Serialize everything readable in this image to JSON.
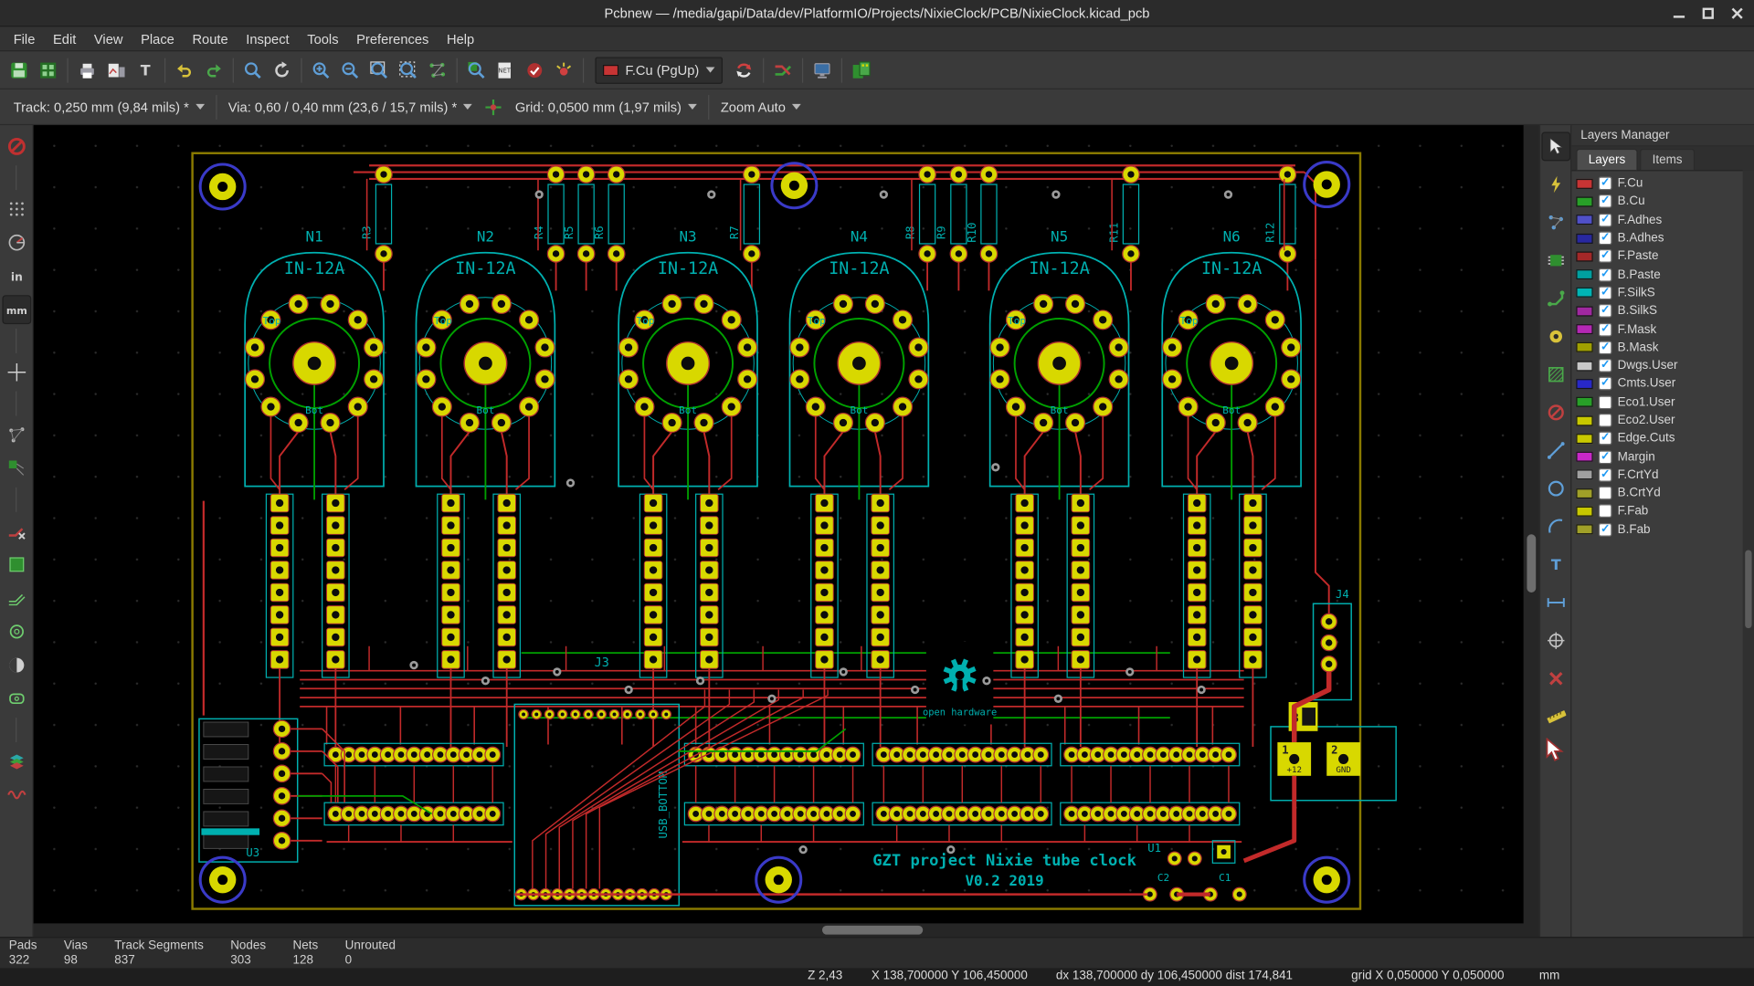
{
  "window": {
    "title": "Pcbnew — /media/gapi/Data/dev/PlatformIO/Projects/NixieClock/PCB/NixieClock.kicad_pcb"
  },
  "menu": {
    "items": [
      "File",
      "Edit",
      "View",
      "Place",
      "Route",
      "Inspect",
      "Tools",
      "Preferences",
      "Help"
    ]
  },
  "toolbar_main": {
    "icons_left": [
      "save-board-icon",
      "footprint-editor-icon",
      "print-icon",
      "plot-icon",
      "text-variables-icon",
      "undo-icon",
      "redo-icon",
      "find-icon",
      "refresh-view-icon",
      "zoom-in-icon",
      "zoom-out-icon",
      "zoom-fit-icon",
      "zoom-selection-icon",
      "show-ratsnest-icon",
      "zoom-footprint-icon",
      "netlist-icon",
      "drc-icon",
      "highlight-net-icon"
    ],
    "layer_selector": {
      "value": "F.Cu (PgUp)",
      "swatch_color": "#c83434"
    },
    "icons_right": [
      "update-pcb-icon",
      "interactive-router-icon",
      "3d-viewer-icon",
      "library-browser-icon"
    ]
  },
  "toolbar_options": {
    "track": "Track: 0,250 mm (9,84 mils) *",
    "via": "Via: 0,60 / 0,40 mm (23,6 / 15,7 mils) *",
    "aux_icon": "track-width-icon",
    "grid": "Grid: 0,0500 mm (1,97 mils)",
    "zoom": "Zoom Auto"
  },
  "left_toolbar": {
    "icons": [
      "drc-off-icon",
      "hide-grid-icon",
      "polar-coords-icon",
      "units-inch-icon",
      "units-mm-icon",
      "cursor-shape-icon",
      "general-ratsnest-icon",
      "footprint-ratsnest-icon",
      "track-autodelete-icon",
      "show-zones-icon",
      "sketch-tracks-icon",
      "sketch-vias-icon",
      "high-contrast-icon",
      "sketch-pads-icon",
      "layers-manager-toggle-icon",
      "microwave-tools-icon"
    ]
  },
  "right_toolbar": {
    "icons": [
      "select-tool-icon",
      "highlight-net-tool-icon",
      "local-ratsnest-icon",
      "add-footprint-icon",
      "route-tracks-icon",
      "add-via-icon",
      "add-zone-icon",
      "add-keepout-icon",
      "add-line-icon",
      "add-circle-icon",
      "add-arc-icon",
      "add-text-icon",
      "add-dimension-icon",
      "add-target-icon",
      "delete-tool-icon",
      "measure-icon"
    ]
  },
  "layers_manager": {
    "title": "Layers Manager",
    "tabs": [
      "Layers",
      "Items"
    ],
    "active_tab": "Layers",
    "layers": [
      {
        "name": "F.Cu",
        "color": "#c83434",
        "checked": true
      },
      {
        "name": "B.Cu",
        "color": "#28a028",
        "checked": true
      },
      {
        "name": "F.Adhes",
        "color": "#5050c8",
        "checked": true
      },
      {
        "name": "B.Adhes",
        "color": "#2828a0",
        "checked": true
      },
      {
        "name": "F.Paste",
        "color": "#a42828",
        "checked": true
      },
      {
        "name": "B.Paste",
        "color": "#00a0a0",
        "checked": true
      },
      {
        "name": "F.SilkS",
        "color": "#00b4b4",
        "checked": true
      },
      {
        "name": "B.SilkS",
        "color": "#a028a0",
        "checked": true
      },
      {
        "name": "F.Mask",
        "color": "#b428b4",
        "checked": true
      },
      {
        "name": "B.Mask",
        "color": "#a0a000",
        "checked": true
      },
      {
        "name": "Dwgs.User",
        "color": "#c8c8c8",
        "checked": true
      },
      {
        "name": "Cmts.User",
        "color": "#2828c8",
        "checked": true
      },
      {
        "name": "Eco1.User",
        "color": "#28a028",
        "checked": false
      },
      {
        "name": "Eco2.User",
        "color": "#c8c800",
        "checked": false
      },
      {
        "name": "Edge.Cuts",
        "color": "#c8c800",
        "checked": true
      },
      {
        "name": "Margin",
        "color": "#c828c8",
        "checked": true
      },
      {
        "name": "F.CrtYd",
        "color": "#a0a0a0",
        "checked": true
      },
      {
        "name": "B.CrtYd",
        "color": "#a0a028",
        "checked": false
      },
      {
        "name": "F.Fab",
        "color": "#c8c800",
        "checked": false
      },
      {
        "name": "B.Fab",
        "color": "#a0a028",
        "checked": true
      }
    ]
  },
  "pcb": {
    "colors": {
      "fcu": "#c22a2a",
      "bcu": "#00a000",
      "silk": "#00b0b0",
      "pad": "#d8d800",
      "edge": "#8a7a00",
      "hole": "#0c0c0c",
      "via": "#9a9a9a",
      "hole_ring": "#3a3ac8"
    },
    "tubes": [
      {
        "ref": "N1",
        "value": "IN-12A"
      },
      {
        "ref": "N2",
        "value": "IN-12A"
      },
      {
        "ref": "N3",
        "value": "IN-12A"
      },
      {
        "ref": "N4",
        "value": "IN-12A"
      },
      {
        "ref": "N5",
        "value": "IN-12A"
      },
      {
        "ref": "N6",
        "value": "IN-12A"
      }
    ],
    "tube_texts": {
      "top": "Top",
      "bottom": "Bot"
    },
    "resistors": [
      "R3",
      "R4",
      "R5",
      "R6",
      "R7",
      "R8",
      "R9",
      "R10",
      "R11",
      "R12"
    ],
    "labels": {
      "usb": "USB_BOTTOM",
      "j3": "J3",
      "j4": "J4",
      "u1": "U1",
      "u3": "U3",
      "c1": "C1",
      "c2": "C2",
      "oshw": "open hardware"
    },
    "power_pads": [
      {
        "num": "1",
        "name": "+12"
      },
      {
        "num": "2",
        "name": "GND"
      },
      {
        "num": "3",
        "name": ""
      }
    ],
    "title_line1": "GZT project Nixie tube clock",
    "title_line2": "V0.2 2019"
  },
  "status_bar": {
    "fields": [
      {
        "label": "Pads",
        "value": "322"
      },
      {
        "label": "Vias",
        "value": "98"
      },
      {
        "label": "Track Segments",
        "value": "837"
      },
      {
        "label": "Nodes",
        "value": "303"
      },
      {
        "label": "Nets",
        "value": "128"
      },
      {
        "label": "Unrouted",
        "value": "0"
      }
    ]
  },
  "readout": {
    "zoom": "Z 2,43",
    "abs": "X 138,700000 Y 106,450000",
    "rel": "dx 138,700000 dy 106,450000 dist 174,841",
    "grid": "grid X 0,050000 Y 0,050000",
    "units": "mm"
  }
}
